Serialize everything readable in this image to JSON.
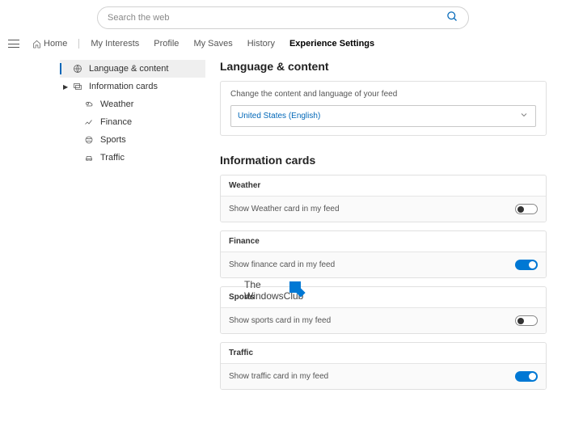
{
  "search": {
    "placeholder": "Search the web"
  },
  "nav": {
    "home": "Home",
    "interests": "My Interests",
    "profile": "Profile",
    "saves": "My Saves",
    "history": "History",
    "exp": "Experience Settings"
  },
  "sidebar": {
    "lang": "Language & content",
    "info": "Information cards",
    "weather": "Weather",
    "finance": "Finance",
    "sports": "Sports",
    "traffic": "Traffic"
  },
  "main": {
    "lang_title": "Language & content",
    "lang_desc": "Change the content and language of your feed",
    "lang_value": "United States (English)",
    "info_title": "Information cards",
    "cards": {
      "weather": {
        "title": "Weather",
        "desc": "Show Weather card in my feed"
      },
      "finance": {
        "title": "Finance",
        "desc": "Show finance card in my feed"
      },
      "sports": {
        "title": "Sports",
        "desc": "Show sports card in my feed"
      },
      "traffic": {
        "title": "Traffic",
        "desc": "Show traffic card in my feed"
      }
    }
  },
  "watermark": {
    "l1": "The",
    "l2": "WindowsClub"
  }
}
